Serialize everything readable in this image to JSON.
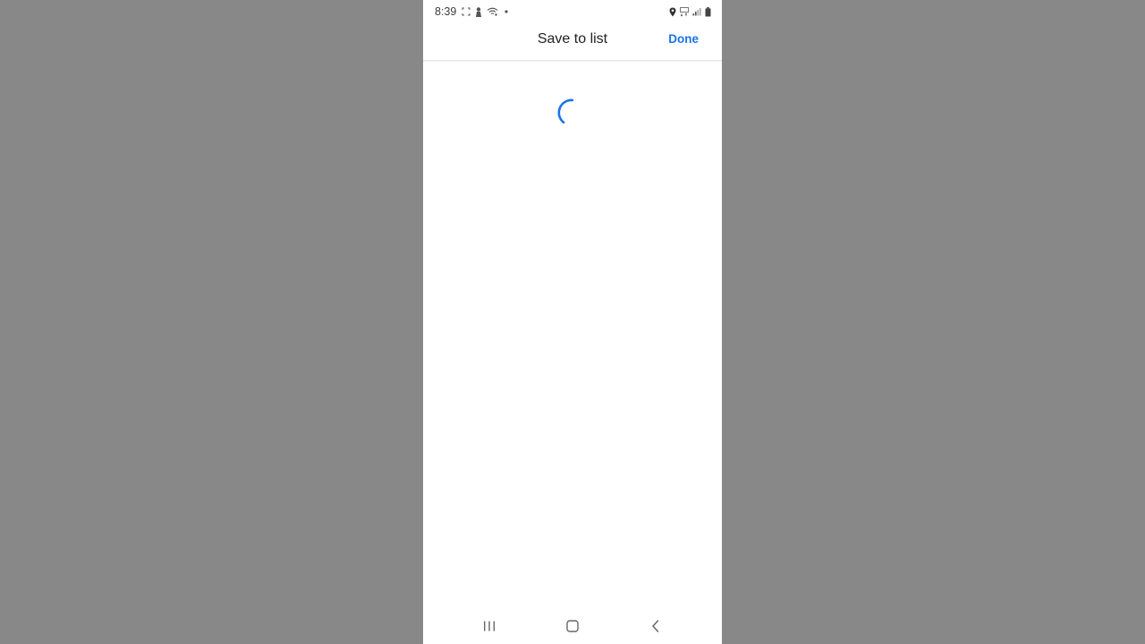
{
  "status_bar": {
    "time": "8:39",
    "left_icons": [
      "screenshot-icon",
      "notification-person-icon",
      "wifi-calling-icon",
      "dot-icon"
    ],
    "right_icons": [
      "location-icon",
      "5g-icon",
      "signal-icon",
      "battery-icon"
    ]
  },
  "header": {
    "title": "Save to list",
    "done_label": "Done"
  },
  "content": {
    "state": "loading",
    "spinner_icon": "progress-spinner-icon"
  },
  "nav_bar": {
    "buttons": [
      "recents-icon",
      "home-icon",
      "back-icon"
    ]
  },
  "colors": {
    "accent": "#1a73e8",
    "backdrop": "#888888",
    "screen": "#ffffff"
  }
}
